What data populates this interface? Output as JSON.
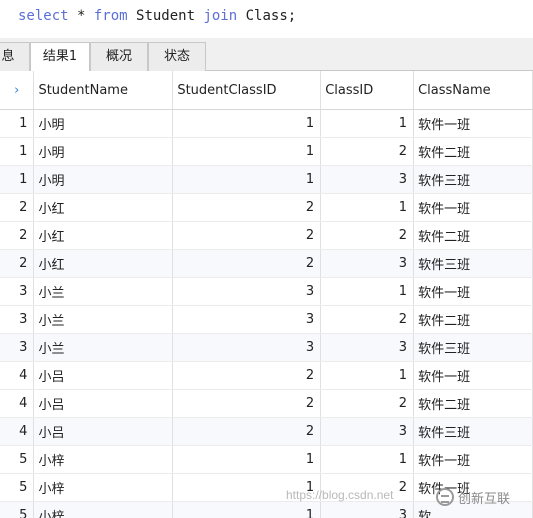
{
  "query": {
    "kw_select": "select",
    "star": " * ",
    "kw_from": "from",
    "t1": " Student ",
    "kw_join": "join",
    "t2": " Class;"
  },
  "tabs": [
    "息",
    "结果1",
    "概况",
    "状态"
  ],
  "active_tab": 1,
  "columns": [
    "StudentName",
    "StudentClassID",
    "ClassID",
    "ClassName"
  ],
  "rows": [
    {
      "id": "1",
      "name": "小明",
      "scid": "1",
      "cid": "1",
      "cname": "软件一班"
    },
    {
      "id": "1",
      "name": "小明",
      "scid": "1",
      "cid": "2",
      "cname": "软件二班"
    },
    {
      "id": "1",
      "name": "小明",
      "scid": "1",
      "cid": "3",
      "cname": "软件三班"
    },
    {
      "id": "2",
      "name": "小红",
      "scid": "2",
      "cid": "1",
      "cname": "软件一班"
    },
    {
      "id": "2",
      "name": "小红",
      "scid": "2",
      "cid": "2",
      "cname": "软件二班"
    },
    {
      "id": "2",
      "name": "小红",
      "scid": "2",
      "cid": "3",
      "cname": "软件三班"
    },
    {
      "id": "3",
      "name": "小兰",
      "scid": "3",
      "cid": "1",
      "cname": "软件一班"
    },
    {
      "id": "3",
      "name": "小兰",
      "scid": "3",
      "cid": "2",
      "cname": "软件二班"
    },
    {
      "id": "3",
      "name": "小兰",
      "scid": "3",
      "cid": "3",
      "cname": "软件三班"
    },
    {
      "id": "4",
      "name": "小吕",
      "scid": "2",
      "cid": "1",
      "cname": "软件一班"
    },
    {
      "id": "4",
      "name": "小吕",
      "scid": "2",
      "cid": "2",
      "cname": "软件二班"
    },
    {
      "id": "4",
      "name": "小吕",
      "scid": "2",
      "cid": "3",
      "cname": "软件三班"
    },
    {
      "id": "5",
      "name": "小梓",
      "scid": "1",
      "cid": "1",
      "cname": "软件一班"
    },
    {
      "id": "5",
      "name": "小梓",
      "scid": "1",
      "cid": "2",
      "cname": "软件一班"
    },
    {
      "id": "5",
      "name": "小梓",
      "scid": "1",
      "cid": "3",
      "cname": "软"
    }
  ],
  "watermark": "https://blog.csdn.net",
  "brand": "创新互联"
}
